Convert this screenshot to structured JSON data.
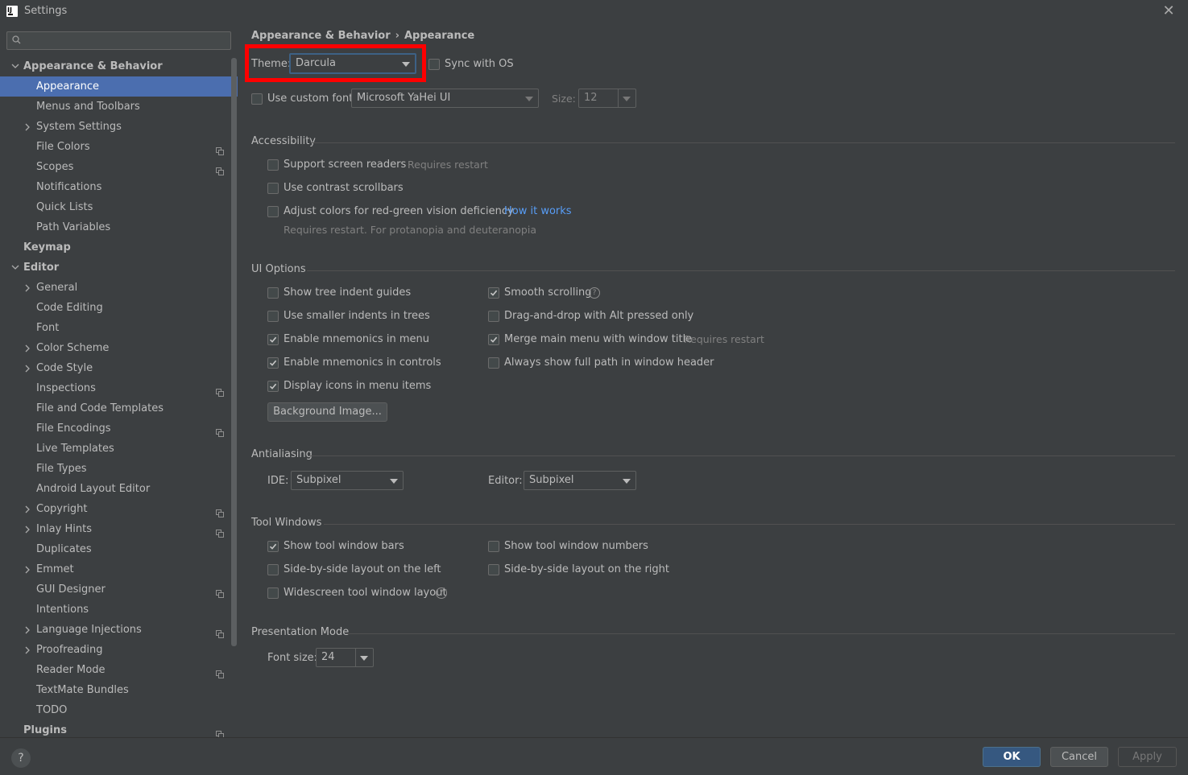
{
  "window": {
    "title": "Settings",
    "close_glyph": "✕"
  },
  "sidebar": {
    "search": {
      "placeholder": "",
      "icon": "search-icon"
    },
    "items": [
      {
        "label": "Appearance & Behavior",
        "expander": "down",
        "bold": true,
        "selected": false,
        "project_icon": false
      },
      {
        "label": "Appearance",
        "expander": "none",
        "bold": false,
        "selected": true,
        "project_icon": false
      },
      {
        "label": "Menus and Toolbars",
        "expander": "none",
        "bold": false,
        "selected": false,
        "project_icon": false
      },
      {
        "label": "System Settings",
        "expander": "right",
        "bold": false,
        "selected": false,
        "project_icon": false
      },
      {
        "label": "File Colors",
        "expander": "none",
        "bold": false,
        "selected": false,
        "project_icon": true
      },
      {
        "label": "Scopes",
        "expander": "none",
        "bold": false,
        "selected": false,
        "project_icon": true
      },
      {
        "label": "Notifications",
        "expander": "none",
        "bold": false,
        "selected": false,
        "project_icon": false
      },
      {
        "label": "Quick Lists",
        "expander": "none",
        "bold": false,
        "selected": false,
        "project_icon": false
      },
      {
        "label": "Path Variables",
        "expander": "none",
        "bold": false,
        "selected": false,
        "project_icon": false
      },
      {
        "label": "Keymap",
        "expander": "none",
        "bold": true,
        "selected": false,
        "project_icon": false
      },
      {
        "label": "Editor",
        "expander": "down",
        "bold": true,
        "selected": false,
        "project_icon": false
      },
      {
        "label": "General",
        "expander": "right",
        "bold": false,
        "selected": false,
        "project_icon": false
      },
      {
        "label": "Code Editing",
        "expander": "none",
        "bold": false,
        "selected": false,
        "project_icon": false
      },
      {
        "label": "Font",
        "expander": "none",
        "bold": false,
        "selected": false,
        "project_icon": false
      },
      {
        "label": "Color Scheme",
        "expander": "right",
        "bold": false,
        "selected": false,
        "project_icon": false
      },
      {
        "label": "Code Style",
        "expander": "right",
        "bold": false,
        "selected": false,
        "project_icon": false
      },
      {
        "label": "Inspections",
        "expander": "none",
        "bold": false,
        "selected": false,
        "project_icon": true
      },
      {
        "label": "File and Code Templates",
        "expander": "none",
        "bold": false,
        "selected": false,
        "project_icon": false
      },
      {
        "label": "File Encodings",
        "expander": "none",
        "bold": false,
        "selected": false,
        "project_icon": true
      },
      {
        "label": "Live Templates",
        "expander": "none",
        "bold": false,
        "selected": false,
        "project_icon": false
      },
      {
        "label": "File Types",
        "expander": "none",
        "bold": false,
        "selected": false,
        "project_icon": false
      },
      {
        "label": "Android Layout Editor",
        "expander": "none",
        "bold": false,
        "selected": false,
        "project_icon": false
      },
      {
        "label": "Copyright",
        "expander": "right",
        "bold": false,
        "selected": false,
        "project_icon": true
      },
      {
        "label": "Inlay Hints",
        "expander": "right",
        "bold": false,
        "selected": false,
        "project_icon": true
      },
      {
        "label": "Duplicates",
        "expander": "none",
        "bold": false,
        "selected": false,
        "project_icon": false
      },
      {
        "label": "Emmet",
        "expander": "right",
        "bold": false,
        "selected": false,
        "project_icon": false
      },
      {
        "label": "GUI Designer",
        "expander": "none",
        "bold": false,
        "selected": false,
        "project_icon": true
      },
      {
        "label": "Intentions",
        "expander": "none",
        "bold": false,
        "selected": false,
        "project_icon": false
      },
      {
        "label": "Language Injections",
        "expander": "right",
        "bold": false,
        "selected": false,
        "project_icon": true
      },
      {
        "label": "Proofreading",
        "expander": "right",
        "bold": false,
        "selected": false,
        "project_icon": false
      },
      {
        "label": "Reader Mode",
        "expander": "none",
        "bold": false,
        "selected": false,
        "project_icon": true
      },
      {
        "label": "TextMate Bundles",
        "expander": "none",
        "bold": false,
        "selected": false,
        "project_icon": false
      },
      {
        "label": "TODO",
        "expander": "none",
        "bold": false,
        "selected": false,
        "project_icon": false
      },
      {
        "label": "Plugins",
        "expander": "none",
        "bold": true,
        "selected": false,
        "project_icon": true
      }
    ]
  },
  "breadcrumb": {
    "parent": "Appearance & Behavior",
    "separator": "›",
    "current": "Appearance"
  },
  "theme": {
    "label": "Theme:",
    "value": "Darcula",
    "sync_label": "Sync with OS",
    "sync_checked": false
  },
  "custom_font": {
    "label": "Use custom font:",
    "checked": false,
    "font_value": "Microsoft YaHei UI",
    "size_label": "Size:",
    "size_value": "12"
  },
  "accessibility": {
    "title": "Accessibility",
    "screen_readers": {
      "label": "Support screen readers",
      "checked": false,
      "hint": "Requires restart"
    },
    "contrast_scrollbars": {
      "label": "Use contrast scrollbars",
      "checked": false
    },
    "color_deficiency": {
      "label": "Adjust colors for red-green vision deficiency",
      "checked": false,
      "link": "How it works",
      "hint": "Requires restart. For protanopia and deuteranopia"
    }
  },
  "ui_options": {
    "title": "UI Options",
    "left": [
      {
        "label": "Show tree indent guides",
        "checked": false
      },
      {
        "label": "Use smaller indents in trees",
        "checked": false
      },
      {
        "label": "Enable mnemonics in menu",
        "checked": true
      },
      {
        "label": "Enable mnemonics in controls",
        "checked": true
      },
      {
        "label": "Display icons in menu items",
        "checked": true
      }
    ],
    "right": [
      {
        "label": "Smooth scrolling",
        "checked": true
      },
      {
        "label": "Drag-and-drop with Alt pressed only",
        "checked": false
      },
      {
        "label": "Merge main menu with window title",
        "checked": true
      },
      {
        "label": "Always show full path in window header",
        "checked": false
      }
    ],
    "merge_hint": "Requires restart",
    "background_button": "Background Image..."
  },
  "antialiasing": {
    "title": "Antialiasing",
    "ide_label": "IDE:",
    "ide_value": "Subpixel",
    "editor_label": "Editor:",
    "editor_value": "Subpixel"
  },
  "tool_windows": {
    "title": "Tool Windows",
    "left": [
      {
        "label": "Show tool window bars",
        "checked": true
      },
      {
        "label": "Side-by-side layout on the left",
        "checked": false
      },
      {
        "label": "Widescreen tool window layout",
        "checked": false
      }
    ],
    "right": [
      {
        "label": "Show tool window numbers",
        "checked": false
      },
      {
        "label": "Side-by-side layout on the right",
        "checked": false
      }
    ]
  },
  "presentation": {
    "title": "Presentation Mode",
    "font_size_label": "Font size:",
    "font_size_value": "24"
  },
  "footer": {
    "help": "?",
    "ok": "OK",
    "cancel": "Cancel",
    "apply": "Apply"
  },
  "colors": {
    "selection": "#4b6eaf",
    "background": "#3c3f41",
    "highlight_box": "#ff0000",
    "link": "#589df6",
    "ok_button": "#365880"
  }
}
